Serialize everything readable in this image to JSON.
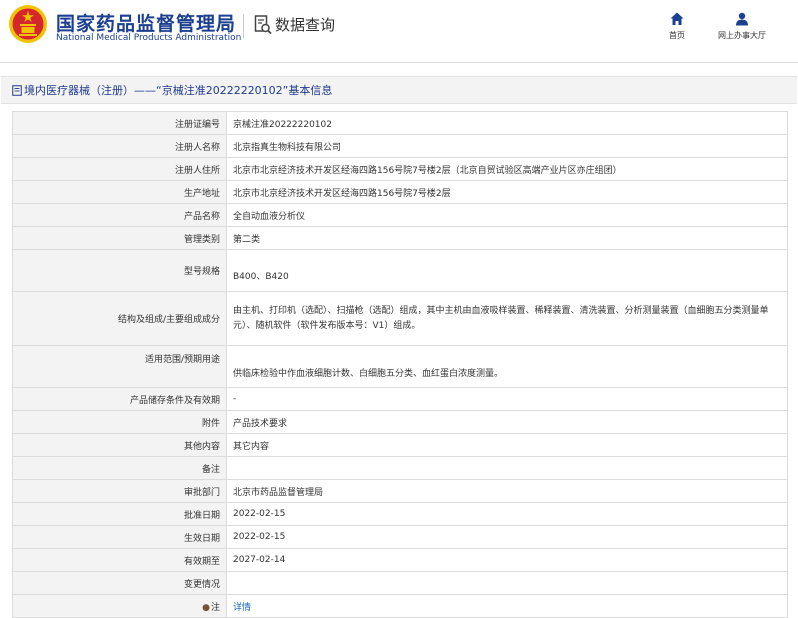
{
  "header": {
    "org_name_cn": "国家药品监督管理局",
    "org_name_en": "National Medical Products Administration",
    "query_label": "数据查询",
    "home_label": "首页",
    "service_label": "网上办事大厅"
  },
  "page": {
    "title": "境内医疗器械（注册）——“京械注准20222220102”基本信息"
  },
  "rows": [
    {
      "label": "注册证编号",
      "value": "京械注准20222220102"
    },
    {
      "label": "注册人名称",
      "value": "北京指真生物科技有限公司"
    },
    {
      "label": "注册人住所",
      "value": "北京市北京经济技术开发区经海四路156号院7号楼2层（北京自贸试验区高端产业片区亦庄组团）"
    },
    {
      "label": "生产地址",
      "value": "北京市北京经济技术开发区经海四路156号院7号楼2层"
    },
    {
      "label": "产品名称",
      "value": "全自动血液分析仪"
    },
    {
      "label": "管理类别",
      "value": "第二类"
    },
    {
      "label": "型号规格",
      "value": "B400、B420"
    },
    {
      "label": "结构及组成/主要组成成分",
      "value": "由主机、打印机（选配）、扫描枪（选配）组成，其中主机由血液吸样装置、稀释装置、清洗装置、分析测量装置（血细胞五分类测量单元）、随机软件（软件发布版本号：V1）组成。"
    },
    {
      "label": "适用范围/预期用途",
      "value": "供临床检验中作血液细胞计数、白细胞五分类、血红蛋白浓度测量。"
    },
    {
      "label": "产品储存条件及有效期",
      "value": "-"
    },
    {
      "label": "附件",
      "value": "产品技术要求"
    },
    {
      "label": "其他内容",
      "value": "其它内容"
    },
    {
      "label": "备注",
      "value": ""
    },
    {
      "label": "审批部门",
      "value": "北京市药品监督管理局"
    },
    {
      "label": "批准日期",
      "value": "2022-02-15"
    },
    {
      "label": "生效日期",
      "value": "2022-02-15"
    },
    {
      "label": "有效期至",
      "value": "2027-02-14"
    },
    {
      "label": "变更情况",
      "value": ""
    },
    {
      "label": "注",
      "value": "详情"
    }
  ],
  "colors": {
    "brand_blue": "#1d3f8f",
    "emblem_red": "#d7262b",
    "emblem_gold": "#f2c200",
    "link_blue": "#1565c0"
  },
  "icons": {
    "emblem": "national-emblem-icon",
    "query": "document-search-icon",
    "home": "home-icon",
    "service": "user-icon",
    "title": "document-icon",
    "note": "pin-icon"
  }
}
